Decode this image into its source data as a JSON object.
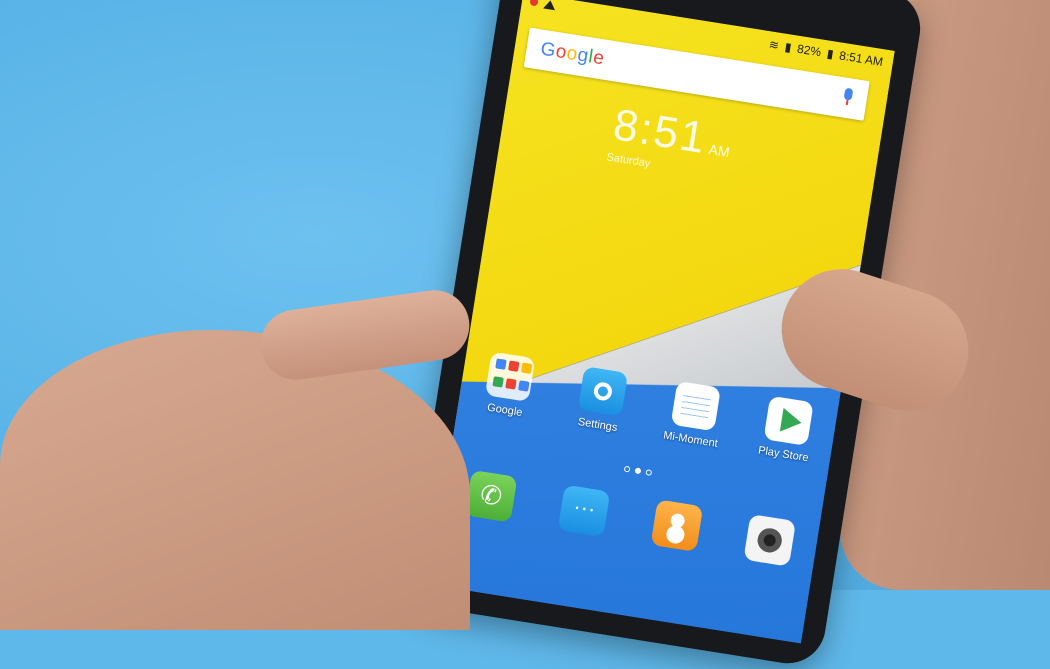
{
  "status_bar": {
    "battery": "82%",
    "time": "8:51 AM"
  },
  "search": {
    "logo": [
      "G",
      "o",
      "o",
      "g",
      "l",
      "e"
    ]
  },
  "lock_clock": {
    "time": "8:51",
    "ampm": "AM",
    "date": "Saturday"
  },
  "apps": [
    {
      "label": "Google"
    },
    {
      "label": "Settings"
    },
    {
      "label": "Mi-Moment"
    },
    {
      "label": "Play Store"
    }
  ],
  "page_indicator": {
    "pages": 3,
    "current": 2
  },
  "dock": [
    "phone",
    "messages",
    "contacts",
    "camera"
  ],
  "colors": {
    "wallpaper_yellow": "#f3d80f",
    "wallpaper_blue": "#2677da",
    "background": "#5fb8ea"
  }
}
